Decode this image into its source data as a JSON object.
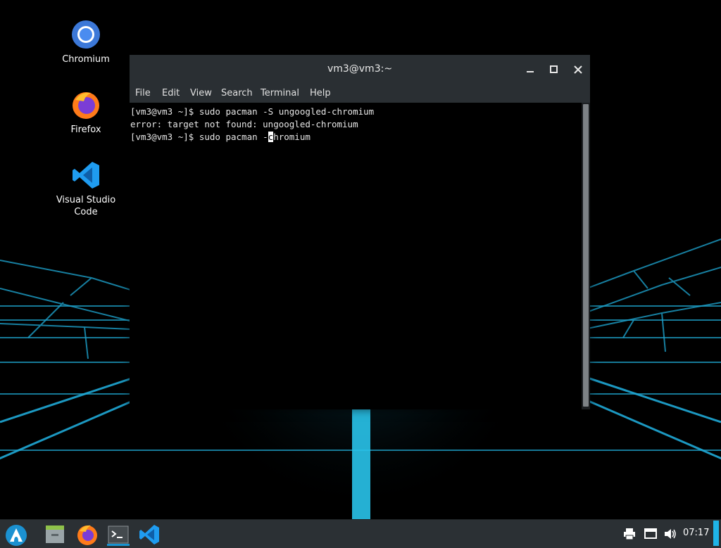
{
  "desktop": {
    "icons": [
      {
        "label": "Chromium"
      },
      {
        "label": "Firefox"
      },
      {
        "label": "Visual Studio Code"
      }
    ]
  },
  "terminal": {
    "title": "vm3@vm3:~",
    "menu": [
      "File",
      "Edit",
      "View",
      "Search",
      "Terminal",
      "Help"
    ],
    "lines": [
      "[vm3@vm3 ~]$ sudo pacman -S ungoogled-chromium",
      "error: target not found: ungoogled-chromium"
    ],
    "current_line": {
      "prefix": "[vm3@vm3 ~]$ sudo pacman -",
      "cursor_char": "c",
      "suffix": "hromium"
    }
  },
  "taskbar": {
    "apps": [
      "app-menu-icon",
      "file-manager-icon",
      "firefox-icon",
      "terminal-icon",
      "vscode-icon"
    ],
    "tray": [
      "printer-icon",
      "display-icon",
      "volume-icon"
    ],
    "clock": "07:17"
  },
  "colors": {
    "accent_cyan": "#1fb4e8",
    "terminal_bg": "#000000",
    "titlebar": "#2a2f33",
    "taskbar": "#2b3034"
  }
}
